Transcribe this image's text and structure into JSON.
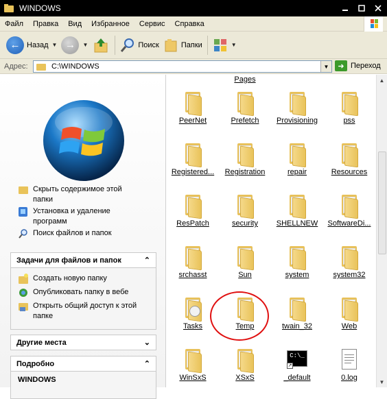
{
  "window": {
    "title": "WINDOWS",
    "title_icon": "folder-icon",
    "controls": [
      "minimize",
      "maximize",
      "close"
    ]
  },
  "menu": {
    "items": [
      "Файл",
      "Правка",
      "Вид",
      "Избранное",
      "Сервис",
      "Справка"
    ]
  },
  "toolbar": {
    "back_label": "Назад",
    "search_label": "Поиск",
    "folders_label": "Папки"
  },
  "address": {
    "label": "Адрес:",
    "value": "C:\\WINDOWS",
    "go_label": "Переход"
  },
  "left": {
    "links": [
      {
        "label": "Скрыть содержимое этой папки",
        "icon": "folder-icon"
      },
      {
        "label": "Установка и удаление программ",
        "icon": "programs-icon"
      },
      {
        "label": "Поиск файлов и папок",
        "icon": "search-icon"
      }
    ],
    "tasks_panel": {
      "title": "Задачи для файлов и папок",
      "items": [
        {
          "label": "Создать новую папку",
          "icon": "new-folder-icon"
        },
        {
          "label": "Опубликовать папку в вебе",
          "icon": "web-publish-icon"
        },
        {
          "label": "Открыть общий доступ к этой папке",
          "icon": "share-icon"
        }
      ]
    },
    "other_places_title": "Другие места",
    "details": {
      "title": "Подробно",
      "name": "WINDOWS"
    }
  },
  "files": {
    "partial_top": "Pages",
    "items": [
      {
        "name": "PeerNet",
        "type": "folder"
      },
      {
        "name": "Prefetch",
        "type": "folder"
      },
      {
        "name": "Provisioning",
        "type": "folder"
      },
      {
        "name": "pss",
        "type": "folder"
      },
      {
        "name": "Registered...",
        "type": "folder"
      },
      {
        "name": "Registration",
        "type": "folder"
      },
      {
        "name": "repair",
        "type": "folder"
      },
      {
        "name": "Resources",
        "type": "folder"
      },
      {
        "name": "ResPatch",
        "type": "folder"
      },
      {
        "name": "security",
        "type": "folder"
      },
      {
        "name": "SHELLNEW",
        "type": "folder"
      },
      {
        "name": "SoftwareDi...",
        "type": "folder"
      },
      {
        "name": "srchasst",
        "type": "folder"
      },
      {
        "name": "Sun",
        "type": "folder"
      },
      {
        "name": "system",
        "type": "folder"
      },
      {
        "name": "system32",
        "type": "folder"
      },
      {
        "name": "Tasks",
        "type": "tasks-folder"
      },
      {
        "name": "Temp",
        "type": "folder",
        "highlighted": true
      },
      {
        "name": "twain_32",
        "type": "folder"
      },
      {
        "name": "Web",
        "type": "folder"
      },
      {
        "name": "WinSxS",
        "type": "folder"
      },
      {
        "name": "XSxS",
        "type": "folder"
      },
      {
        "name": "_default",
        "type": "shortcut"
      },
      {
        "name": "0.log",
        "type": "file"
      }
    ]
  },
  "colors": {
    "highlight_circle": "#e01010",
    "folder": "#f0cf73",
    "title_bar": "#000000"
  }
}
